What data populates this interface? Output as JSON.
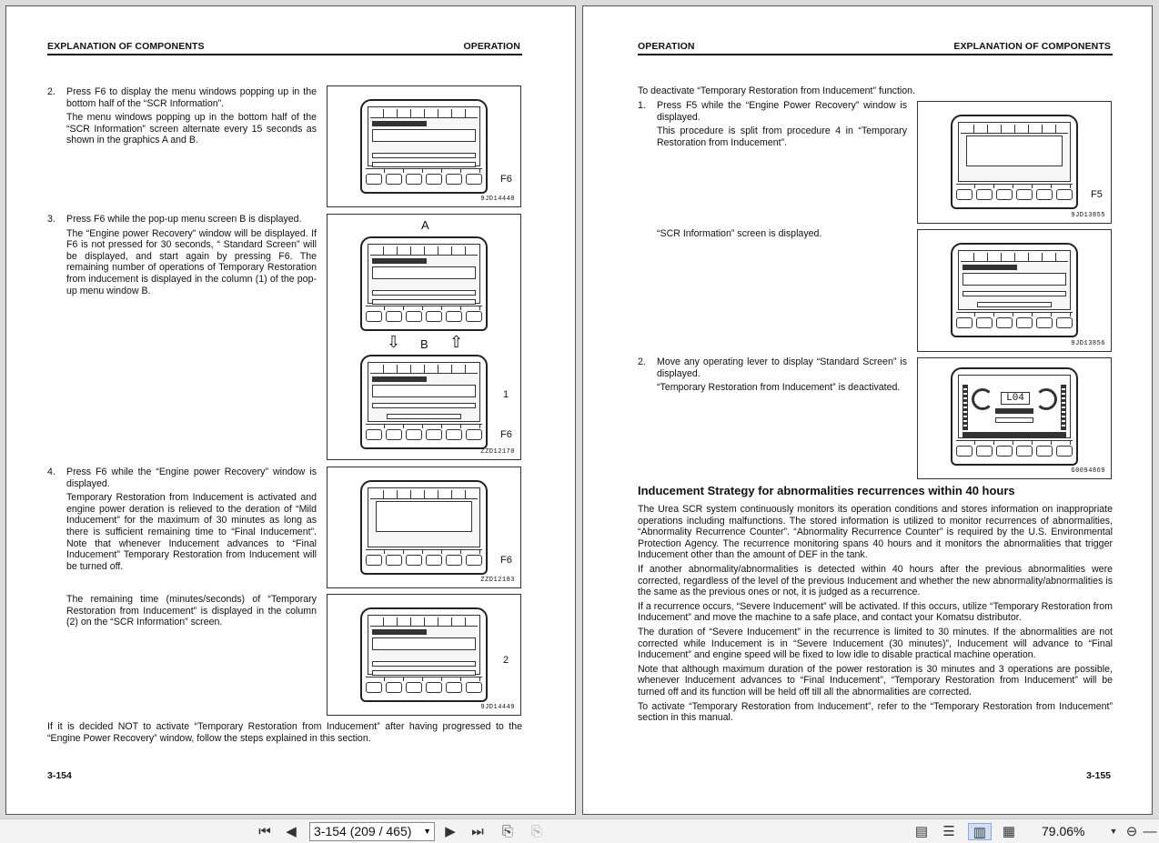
{
  "left_page": {
    "header_left": "EXPLANATION OF COMPONENTS",
    "header_right": "OPERATION",
    "page_number": "3-154",
    "steps": [
      {
        "num": "2.",
        "paras": [
          "Press F6 to display the menu windows popping up in the bottom half of the “SCR Information”.",
          "The menu windows popping up in the bottom half of the “SCR Information” screen alternate every 15 seconds as shown in the graphics A and B."
        ]
      },
      {
        "num": "3.",
        "paras": [
          "Press F6 while the pop-up menu screen B is displayed.",
          "The “Engine power Recovery” window will be displayed. If F6 is not pressed for 30 seconds, “ Standard Screen” will be displayed, and start again by pressing F6. The remaining number of operations of Temporary Restoration from inducement is displayed in the column (1) of the pop-up menu window B."
        ]
      },
      {
        "num": "4.",
        "paras": [
          "Press F6 while the “Engine power Recovery” window is displayed.",
          "Temporary Restoration from Inducement is activated and engine power deration is relieved to the deration of “Mild Inducement” for the maximum of 30 minutes as long as there is sufficient remaining time to “Final Inducement”. Note that whenever Inducement advances to “Final Inducement” Temporary Restoration from Inducement will be turned off."
        ]
      },
      {
        "num": "",
        "paras": [
          "The remaining time (minutes/seconds) of “Temporary Restoration from Inducement” is displayed in the column (2) on the “SCR Information” screen."
        ]
      }
    ],
    "footer_text": "If it is decided NOT to activate “Temporary Restoration from Inducement” after having progressed to the “Engine Power Recovery” window, follow the steps explained in this section.",
    "figures": [
      {
        "code": "9JD14448",
        "label": "F6"
      },
      {
        "code": "ZZD12170",
        "label_a": "A",
        "label_b": "B",
        "label_1": "1",
        "label": "F6"
      },
      {
        "code": "ZZD12183",
        "label": "F6"
      },
      {
        "code": "9JD14449",
        "label": "2"
      }
    ]
  },
  "right_page": {
    "header_left": "OPERATION",
    "header_right": "EXPLANATION OF COMPONENTS",
    "page_number": "3-155",
    "intro": "To deactivate “Temporary Restoration from Inducement” function.",
    "step1": {
      "num": "1.",
      "paras": [
        "Press F5 while the “Engine Power Recovery” window is displayed.",
        "This procedure is split from procedure 4 in “Temporary Restoration from Inducement”."
      ]
    },
    "step1b": "“SCR Information” screen is displayed.",
    "step2": {
      "num": "2.",
      "paras": [
        "Move any operating lever to display “Standard Screen” is displayed.",
        "“Temporary Restoration from Inducement” is deactivated."
      ]
    },
    "figures": [
      {
        "code": "9JD13855",
        "label": "F5"
      },
      {
        "code": "9JD13856"
      },
      {
        "code": "G0094869",
        "lcd_text": "L04"
      }
    ],
    "section_title": "Inducement Strategy for abnormalities recurrences within 40 hours",
    "section_paras": [
      "The Urea SCR system continuously monitors its operation conditions and stores information on inappropriate operations including malfunctions. The stored information is utilized to monitor recurrences of abnormalities, “Abnormality Recurrence Counter”. “Abnormality Recurrence Counter” is required by the U.S. Environmental Protection Agency. The recurrence monitoring spans 40 hours and it monitors the abnormalities that trigger Inducement other than the amount of DEF in the tank.",
      "If another abnormality/abnormalities is detected within 40 hours after the previous abnormalities were corrected, regardless of the level of the previous Inducement and whether the new abnormality/abnormalities is the same as the previous ones or not, it is judged as a recurrence.",
      "If a recurrence occurs, “Severe Inducement” will be activated. If this occurs, utilize “Temporary Restoration from Inducement” and move the machine to a safe place, and contact your Komatsu distributor.",
      "The duration of “Severe Inducement” in the recurrence is limited to 30 minutes. If the abnormalities are not corrected while Inducement is in “Severe Inducement (30 minutes)”, Inducement will advance to “Final Inducement” and engine speed will be fixed to low idle to disable practical machine operation.",
      "Note that although maximum duration of the power restoration is 30 minutes and 3 operations are possible, whenever Inducement advances to “Final Inducement”, “Temporary Restoration from Inducement” will be turned off and its function will be held off till all the abnormalities are corrected.",
      "To activate “Temporary Restoration from Inducement”, refer to the “Temporary Restoration from Inducement” section in this manual."
    ]
  },
  "toolbar": {
    "page_field": "3-154 (209 / 465)",
    "zoom": "79.06%"
  }
}
